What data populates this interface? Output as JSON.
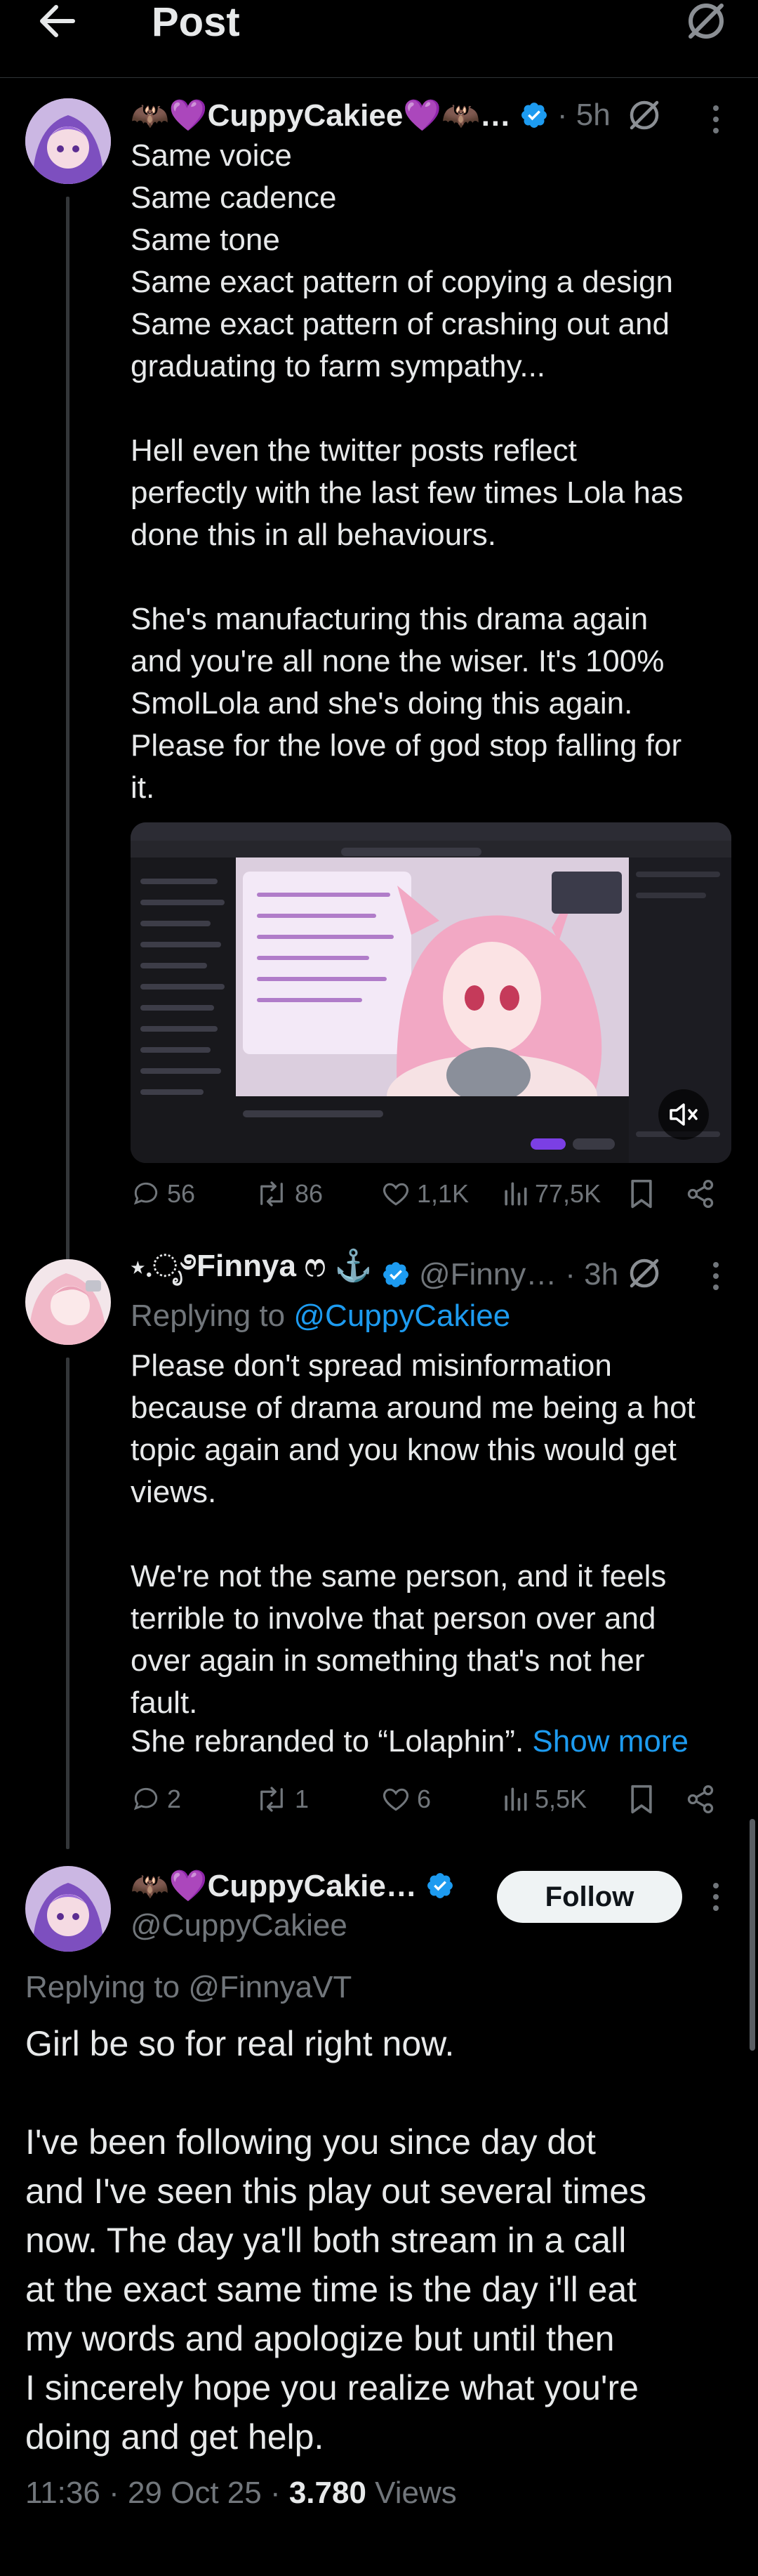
{
  "header": {
    "title": "Post"
  },
  "post1": {
    "display_name": "🦇💜CuppyCakiee💜🦇…",
    "time": "· 5h",
    "body": "Same voice\nSame cadence\nSame tone\nSame exact pattern of copying a design\nSame exact pattern of crashing out and\ngraduating to farm sympathy...\n\nHell even the twitter posts reflect\nperfectly with the last few times Lola has\ndone this in all behaviours.\n\nShe's manufacturing this drama again\nand you're all none the wiser. It's 100%\nSmolLola and she's doing this again.\nPlease for the love of god stop falling for\nit.",
    "stats": {
      "replies": "56",
      "reposts": "86",
      "likes": "1,1K",
      "views": "77,5K"
    }
  },
  "post2": {
    "display_name": "⋆.ೃ࿔Finnya ෆ ⚓",
    "handle": "@Finny…",
    "time": "· 3h",
    "replying_label": "Replying to",
    "replying_to": "@CuppyCakiee",
    "body": "Please don't spread misinformation\nbecause of drama around me being a hot\ntopic again and you know this would get\nviews.\n\nWe're not the same person, and it feels\nterrible to involve that person over and\nover again in something that's not her\nfault.",
    "last_line": "She rebranded to “Lolaphin”.",
    "show_more": "Show more",
    "stats": {
      "replies": "2",
      "reposts": "1",
      "likes": "6",
      "views": "5,5K"
    }
  },
  "post3": {
    "display_name": "🦇💜CuppyCakie…",
    "handle": "@CuppyCakiee",
    "follow_label": "Follow",
    "replying_to": "Replying to @FinnyaVT",
    "body": "Girl be so for real right now.\n\nI've been following you since day dot\nand I've seen this play out several times\nnow. The day ya'll both stream in a call\nat the exact same time is the day i'll eat\nmy words and apologize but until then\nI sincerely hope you realize what you're\ndoing and get help.",
    "timestamp": "11:36 · 29 Oct 25 · ",
    "views_count": "3.780",
    "views_label": " Views"
  },
  "colors": {
    "accent": "#1d9bf0",
    "background": "#000000",
    "muted": "#71767b",
    "text": "#e7e9ea"
  }
}
